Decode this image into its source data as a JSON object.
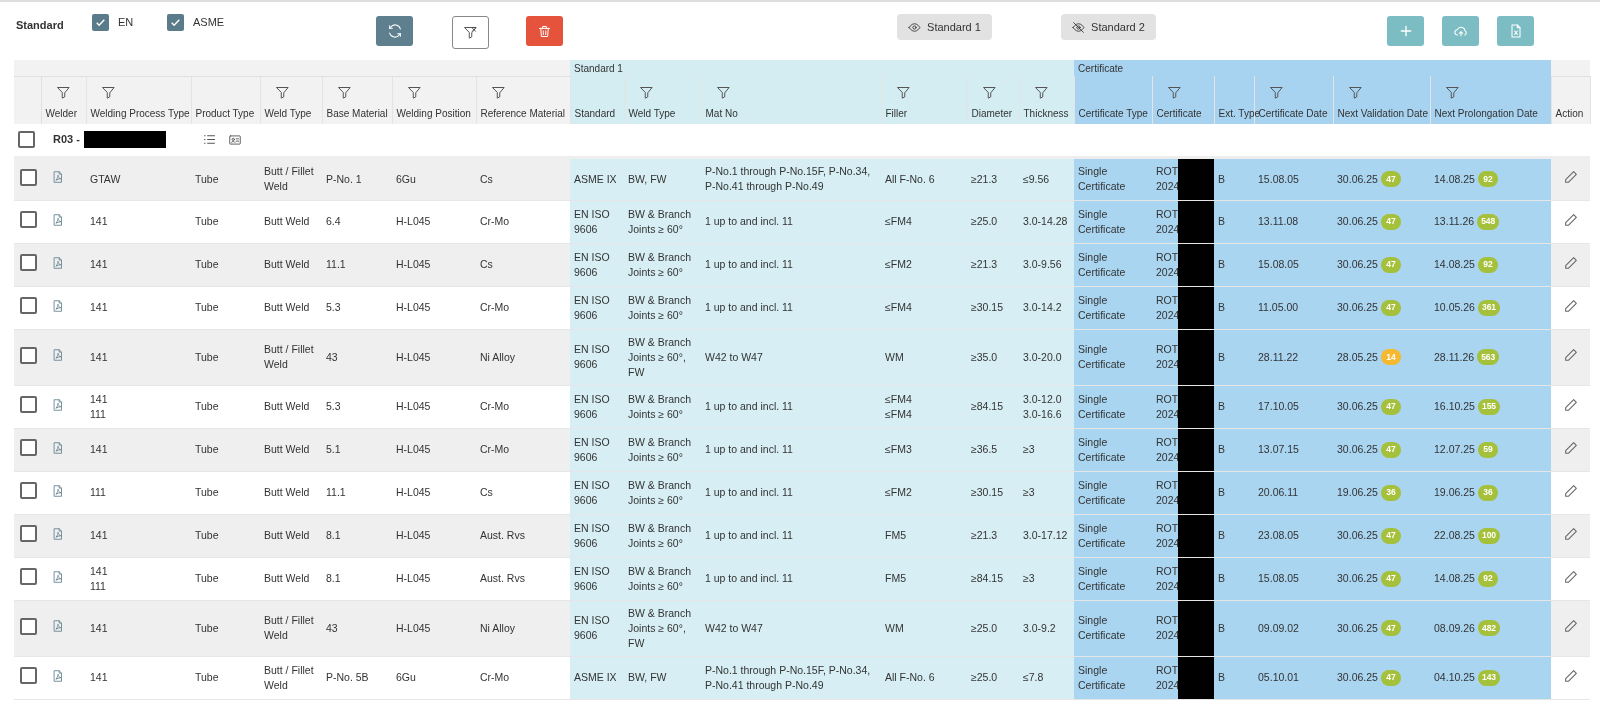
{
  "toolbar": {
    "label": "Standard",
    "filters": [
      {
        "label": "EN",
        "checked": true
      },
      {
        "label": "ASME",
        "checked": true
      }
    ],
    "views": [
      {
        "label": "Standard 1",
        "visible": true
      },
      {
        "label": "Standard 2",
        "visible": false
      }
    ]
  },
  "table": {
    "groups": [
      {
        "kind": "standard",
        "label": "Standard 1"
      },
      {
        "kind": "certificate",
        "label": "Certificate"
      }
    ],
    "columns": [
      {
        "label": "Welder",
        "filterable": true,
        "kind": "general"
      },
      {
        "label": "Welding Process Type",
        "filterable": true,
        "kind": "general"
      },
      {
        "label": "Product Type",
        "filterable": false,
        "kind": "general"
      },
      {
        "label": "Weld Type",
        "filterable": true,
        "kind": "general"
      },
      {
        "label": "Base Material",
        "filterable": true,
        "kind": "general"
      },
      {
        "label": "Welding Position",
        "filterable": true,
        "kind": "general"
      },
      {
        "label": "Reference Material",
        "filterable": true,
        "kind": "general"
      },
      {
        "label": "Standard",
        "filterable": false,
        "kind": "standard"
      },
      {
        "label": "Weld Type",
        "filterable": true,
        "kind": "standard"
      },
      {
        "label": "Mat No",
        "filterable": true,
        "kind": "standard"
      },
      {
        "label": "Filler",
        "filterable": true,
        "kind": "standard"
      },
      {
        "label": "Diameter",
        "filterable": true,
        "kind": "standard"
      },
      {
        "label": "Thickness",
        "filterable": true,
        "kind": "standard"
      },
      {
        "label": "Certificate Type",
        "filterable": false,
        "kind": "certificate"
      },
      {
        "label": "Certificate",
        "filterable": true,
        "kind": "certificate"
      },
      {
        "label": "Ext. Type",
        "filterable": false,
        "kind": "certificate"
      },
      {
        "label": "Certificate Date",
        "filterable": true,
        "kind": "certificate"
      },
      {
        "label": "Next Validation Date",
        "filterable": true,
        "kind": "certificate"
      },
      {
        "label": "Next Prolongation Date",
        "filterable": true,
        "kind": "certificate"
      },
      {
        "label": "Action",
        "filterable": false,
        "kind": "action"
      }
    ],
    "group_row": {
      "label": "R03 -",
      "selected": false
    },
    "rows": [
      {
        "selected": false,
        "cells": [
          "",
          "GTAW",
          "Tube",
          "Butt / Fillet Weld",
          "P-No. 1",
          "6Gu",
          "Cs",
          "ASME IX",
          "BW, FW",
          "P-No.1 through P-No.15F, P-No.34, P-No.41 through P-No.49",
          "All F-No. 6",
          "≥21.3",
          "≤9.56",
          "Single Certificate",
          "ROT\n2024",
          "B",
          "15.08.05"
        ],
        "validation": {
          "date": "30.06.25",
          "days": "47",
          "color": "#a5c03a"
        },
        "prolongation": {
          "date": "14.08.25",
          "days": "92",
          "color": "#a5c03a"
        }
      },
      {
        "selected": false,
        "cells": [
          "",
          "141",
          "Tube",
          "Butt Weld",
          "6.4",
          "H-L045",
          "Cr-Mo",
          "EN ISO 9606",
          "BW & Branch Joints ≥ 60°",
          "1 up to and incl. 11",
          "≤FM4",
          "≥25.0",
          "3.0-14.28",
          "Single Certificate",
          "ROT\n2024",
          "B",
          "13.11.08"
        ],
        "validation": {
          "date": "30.06.25",
          "days": "47",
          "color": "#a5c03a"
        },
        "prolongation": {
          "date": "13.11.26",
          "days": "548",
          "color": "#a5c03a"
        }
      },
      {
        "selected": false,
        "cells": [
          "",
          "141",
          "Tube",
          "Butt Weld",
          "11.1",
          "H-L045",
          "Cs",
          "EN ISO 9606",
          "BW & Branch Joints ≥ 60°",
          "1 up to and incl. 11",
          "≤FM2",
          "≥21.3",
          "3.0-9.56",
          "Single Certificate",
          "ROT\n2024",
          "B",
          "15.08.05"
        ],
        "validation": {
          "date": "30.06.25",
          "days": "47",
          "color": "#a5c03a"
        },
        "prolongation": {
          "date": "14.08.25",
          "days": "92",
          "color": "#a5c03a"
        }
      },
      {
        "selected": false,
        "cells": [
          "",
          "141",
          "Tube",
          "Butt Weld",
          "5.3",
          "H-L045",
          "Cr-Mo",
          "EN ISO 9606",
          "BW & Branch Joints ≥ 60°",
          "1 up to and incl. 11",
          "≤FM4",
          "≥30.15",
          "3.0-14.2",
          "Single Certificate",
          "ROT\n2024",
          "B",
          "11.05.00"
        ],
        "validation": {
          "date": "30.06.25",
          "days": "47",
          "color": "#a5c03a"
        },
        "prolongation": {
          "date": "10.05.26",
          "days": "361",
          "color": "#a5c03a"
        }
      },
      {
        "selected": false,
        "cells": [
          "",
          "141",
          "Tube",
          "Butt / Fillet Weld",
          "43",
          "H-L045",
          "Ni Alloy",
          "EN ISO 9606",
          "BW & Branch Joints ≥ 60°, FW",
          "W42 to W47",
          "WM",
          "≥35.0",
          "3.0-20.0",
          "Single Certificate",
          "ROT\n2024",
          "B",
          "28.11.22"
        ],
        "validation": {
          "date": "28.05.25",
          "days": "14",
          "color": "#f5b82e"
        },
        "prolongation": {
          "date": "28.11.26",
          "days": "563",
          "color": "#a5c03a"
        }
      },
      {
        "selected": false,
        "cells": [
          "",
          "141\n111",
          "Tube",
          "Butt Weld",
          "5.3",
          "H-L045",
          "Cr-Mo",
          "EN ISO 9606",
          "BW & Branch Joints ≥ 60°",
          "1 up to and incl. 11",
          "≤FM4\n≤FM4",
          "≥84.15",
          "3.0-12.0\n3.0-16.6",
          "Single Certificate",
          "ROT\n2024",
          "B",
          "17.10.05"
        ],
        "validation": {
          "date": "30.06.25",
          "days": "47",
          "color": "#a5c03a"
        },
        "prolongation": {
          "date": "16.10.25",
          "days": "155",
          "color": "#a5c03a"
        }
      },
      {
        "selected": false,
        "cells": [
          "",
          "141",
          "Tube",
          "Butt Weld",
          "5.1",
          "H-L045",
          "Cr-Mo",
          "EN ISO 9606",
          "BW & Branch Joints ≥ 60°",
          "1 up to and incl. 11",
          "≤FM3",
          "≥36.5",
          "≥3",
          "Single Certificate",
          "ROT\n2024",
          "B",
          "13.07.15"
        ],
        "validation": {
          "date": "30.06.25",
          "days": "47",
          "color": "#a5c03a"
        },
        "prolongation": {
          "date": "12.07.25",
          "days": "59",
          "color": "#a5c03a"
        }
      },
      {
        "selected": false,
        "cells": [
          "",
          "111",
          "Tube",
          "Butt Weld",
          "11.1",
          "H-L045",
          "Cs",
          "EN ISO 9606",
          "BW & Branch Joints ≥ 60°",
          "1 up to and incl. 11",
          "≤FM2",
          "≥30.15",
          "≥3",
          "Single Certificate",
          "ROT\n2024",
          "B",
          "20.06.11"
        ],
        "validation": {
          "date": "19.06.25",
          "days": "36",
          "color": "#a5c03a"
        },
        "prolongation": {
          "date": "19.06.25",
          "days": "36",
          "color": "#a5c03a"
        }
      },
      {
        "selected": false,
        "cells": [
          "",
          "141",
          "Tube",
          "Butt Weld",
          "8.1",
          "H-L045",
          "Aust. Rvs",
          "EN ISO 9606",
          "BW & Branch Joints ≥ 60°",
          "1 up to and incl. 11",
          "FM5",
          "≥21.3",
          "3.0-17.12",
          "Single Certificate",
          "ROT\n2024",
          "B",
          "23.08.05"
        ],
        "validation": {
          "date": "30.06.25",
          "days": "47",
          "color": "#a5c03a"
        },
        "prolongation": {
          "date": "22.08.25",
          "days": "100",
          "color": "#a5c03a"
        }
      },
      {
        "selected": false,
        "cells": [
          "",
          "141\n111",
          "Tube",
          "Butt Weld",
          "8.1",
          "H-L045",
          "Aust. Rvs",
          "EN ISO 9606",
          "BW & Branch Joints ≥ 60°",
          "1 up to and incl. 11",
          "FM5",
          "≥84.15",
          "≥3",
          "Single Certificate",
          "ROT\n2024",
          "B",
          "15.08.05"
        ],
        "validation": {
          "date": "30.06.25",
          "days": "47",
          "color": "#a5c03a"
        },
        "prolongation": {
          "date": "14.08.25",
          "days": "92",
          "color": "#a5c03a"
        }
      },
      {
        "selected": false,
        "cells": [
          "",
          "141",
          "Tube",
          "Butt / Fillet Weld",
          "43",
          "H-L045",
          "Ni Alloy",
          "EN ISO 9606",
          "BW & Branch Joints ≥ 60°, FW",
          "W42 to W47",
          "WM",
          "≥25.0",
          "3.0-9.2",
          "Single Certificate",
          "ROT\n2024",
          "B",
          "09.09.02"
        ],
        "validation": {
          "date": "30.06.25",
          "days": "47",
          "color": "#a5c03a"
        },
        "prolongation": {
          "date": "08.09.26",
          "days": "482",
          "color": "#a5c03a"
        }
      },
      {
        "selected": false,
        "cells": [
          "",
          "141",
          "Tube",
          "Butt / Fillet Weld",
          "P-No. 5B",
          "6Gu",
          "Cr-Mo",
          "ASME IX",
          "BW, FW",
          "P-No.1 through P-No.15F, P-No.34, P-No.41 through P-No.49",
          "All F-No. 6",
          "≥25.0",
          "≤7.8",
          "Single Certificate",
          "ROT\n2024",
          "B",
          "05.10.01"
        ],
        "validation": {
          "date": "30.06.25",
          "days": "47",
          "color": "#a5c03a"
        },
        "prolongation": {
          "date": "04.10.25",
          "days": "143",
          "color": "#a5c03a"
        }
      }
    ]
  }
}
